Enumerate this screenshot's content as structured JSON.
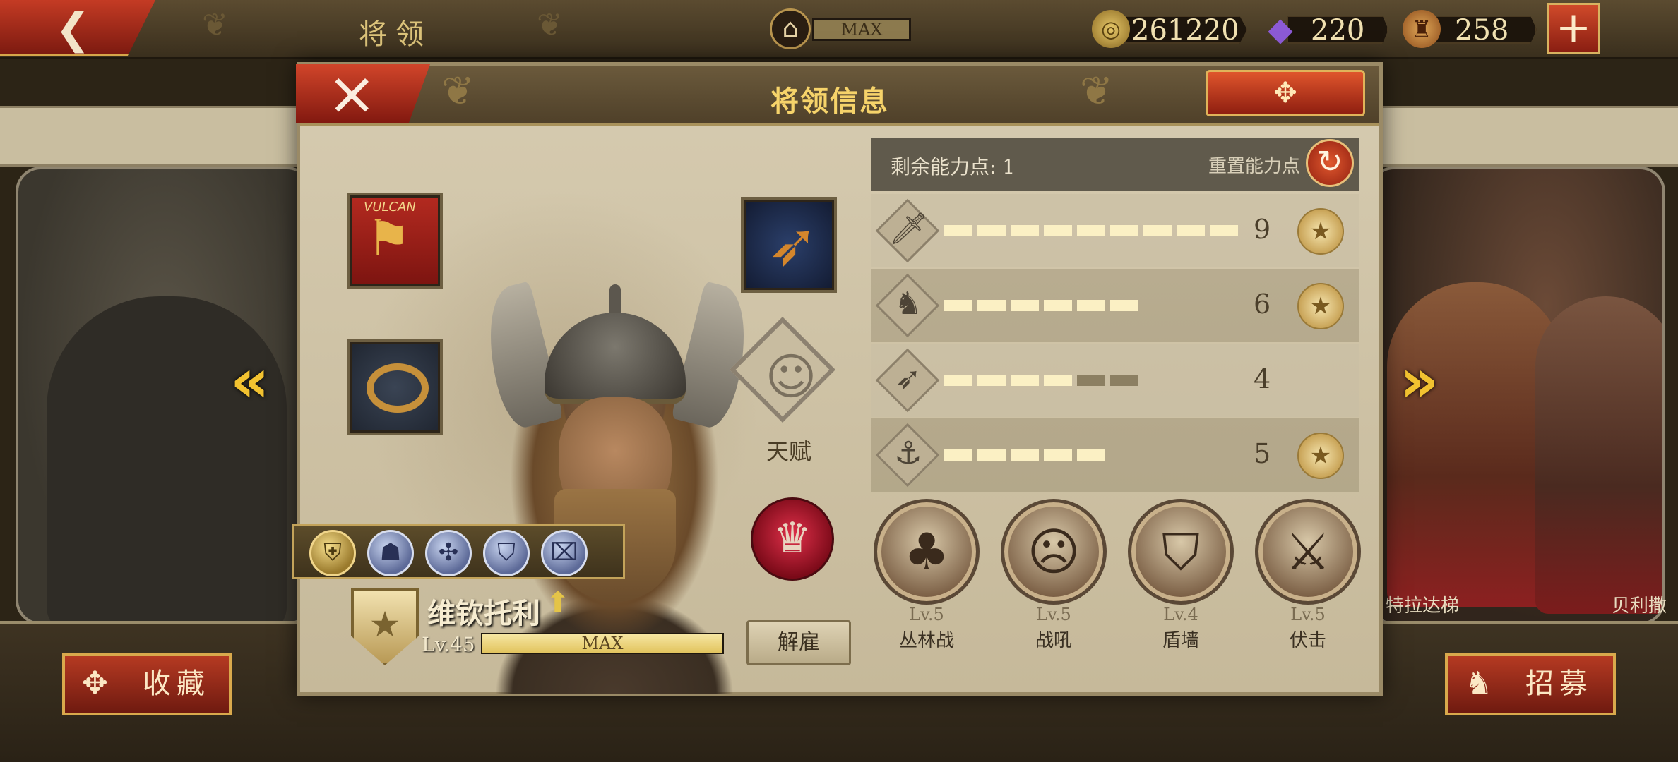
{
  "topbar": {
    "title": "将领",
    "building_label": "MAX",
    "resources": [
      {
        "icon": "coin-icon",
        "value": "261220"
      },
      {
        "icon": "gem-icon",
        "value": "220"
      },
      {
        "icon": "spqr-helmet-icon",
        "value": "258"
      }
    ]
  },
  "background": {
    "right_names": [
      "特拉达梯",
      "贝利撒"
    ]
  },
  "bottom": {
    "favorite_label": "收藏",
    "recruit_label": "招募"
  },
  "modal": {
    "title": "将领信息",
    "banner_text": "VULCAN",
    "talent_label": "天赋",
    "hero": {
      "name": "维钦托利",
      "level": "Lv.45",
      "level_bar_label": "MAX",
      "level_progress": 1.0,
      "dismiss_label": "解雇"
    },
    "badges": [
      "gold",
      "blue",
      "blue",
      "blue",
      "blue"
    ],
    "stats_panel": {
      "remaining_label": "剩余能力点: 1",
      "reset_label": "重置能力点",
      "stats": [
        {
          "icon": "sword-icon",
          "value": "9",
          "filled": 9,
          "half": 0,
          "medal": true
        },
        {
          "icon": "horse-icon",
          "value": "6",
          "filled": 6,
          "half": 0,
          "medal": true
        },
        {
          "icon": "bow-icon",
          "value": "4",
          "filled": 4,
          "half": 2,
          "medal": false
        },
        {
          "icon": "anchor-icon",
          "value": "5",
          "filled": 5,
          "half": 0,
          "medal": true
        }
      ]
    },
    "skills": [
      {
        "level": "Lv.5",
        "name": "丛林战",
        "icon": "forest-icon"
      },
      {
        "level": "Lv.5",
        "name": "战吼",
        "icon": "war-cry-icon"
      },
      {
        "level": "Lv.4",
        "name": "盾墙",
        "icon": "shield-wall-icon"
      },
      {
        "level": "Lv.5",
        "name": "伏击",
        "icon": "ambush-icon"
      }
    ]
  },
  "colors": {
    "accent_red": "#b53a22",
    "gold": "#f2c230",
    "panel": "#d6cbb0"
  }
}
